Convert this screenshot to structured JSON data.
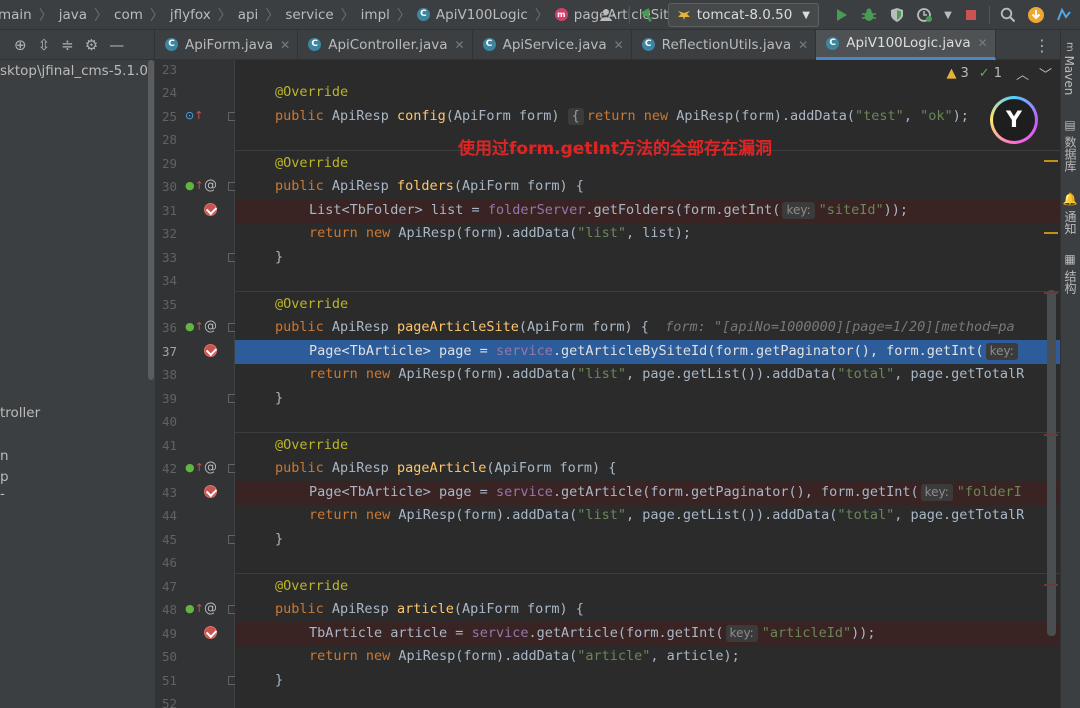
{
  "breadcrumb": [
    "main",
    "java",
    "com",
    "jflyfox",
    "api",
    "service",
    "impl",
    "ApiV100Logic",
    "pageArticleSite"
  ],
  "toolbar": {
    "run_config": "tomcat-8.0.50",
    "user_icon": "user-icon",
    "build_icon": "hammer-icon",
    "run_icon": "play-icon",
    "debug_icon": "bug-icon",
    "stop_icon": "stop-icon",
    "search_icon": "search-icon",
    "update_icon": "update-icon",
    "colors": {
      "run": "#499c54",
      "stop": "#c75450",
      "update": "#f0a732"
    }
  },
  "tabs": [
    {
      "label": "ApiForm.java",
      "active": false
    },
    {
      "label": "ApiController.java",
      "active": false
    },
    {
      "label": "ApiService.java",
      "active": false
    },
    {
      "label": "ReflectionUtils.java",
      "active": false
    },
    {
      "label": "ApiV100Logic.java",
      "active": true
    }
  ],
  "project_panel": {
    "path": "sktop\\jfinal_cms-5.1.0",
    "items": [
      "troller",
      "n",
      "p",
      "-"
    ]
  },
  "inspections": {
    "warnings": "3",
    "ok": "1"
  },
  "annotation_text": "使用过form.getInt方法的全部存在漏洞",
  "right_tools": [
    "Maven",
    "数据库",
    "通知",
    "结构"
  ],
  "editor": {
    "line_numbers": [
      "23",
      "24",
      "25",
      "28",
      "29",
      "30",
      "31",
      "32",
      "33",
      "34",
      "35",
      "36",
      "37",
      "38",
      "39",
      "40",
      "41",
      "42",
      "43",
      "44",
      "45",
      "46",
      "47",
      "48",
      "49",
      "50",
      "51",
      "52"
    ],
    "current_line": "37",
    "breakpoint_lines": [
      "31",
      "37",
      "43",
      "49"
    ],
    "hint_key": "key:",
    "lines": {
      "l24": "@Override",
      "l25_a": "public",
      "l25_b": "ApiResp",
      "l25_c": "config",
      "l25_d": "(ApiForm form) ",
      "l25_fold": "{",
      "l25_e": "return new",
      "l25_f": " ApiResp(form).addData(",
      "l25_g": "\"test\"",
      "l25_h": ", ",
      "l25_i": "\"ok\"",
      "l25_j": ");",
      "l29": "@Override",
      "l30_a": "public",
      "l30_b": " ApiResp ",
      "l30_c": "folders",
      "l30_d": "(ApiForm form) {",
      "l31_a": "List<TbFolder> list = ",
      "l31_b": "folderServer",
      "l31_c": ".getFolders(form.getInt(",
      "l31_d": "\"siteId\"",
      "l31_e": "));",
      "l32_a": "return new",
      "l32_b": " ApiResp(form).addData(",
      "l32_c": "\"list\"",
      "l32_d": ", list);",
      "l33": "}",
      "l35": "@Override",
      "l36_a": "public",
      "l36_b": " ApiResp ",
      "l36_c": "pageArticleSite",
      "l36_d": "(ApiForm form) {",
      "l36_e": "form: \"[apiNo=1000000][page=1/20][method=pa",
      "l37_a": "Page<TbArticle> page = ",
      "l37_b": "service",
      "l37_c": ".getArticleBySiteId(form.getPaginator(), form.getInt(",
      "l38_a": "return new",
      "l38_b": " ApiResp(form).addData(",
      "l38_c": "\"list\"",
      "l38_d": ", page.getList()).addData(",
      "l38_e": "\"total\"",
      "l38_f": ", page.getTotalR",
      "l39": "}",
      "l41": "@Override",
      "l42_a": "public",
      "l42_b": " ApiResp ",
      "l42_c": "pageArticle",
      "l42_d": "(ApiForm form) {",
      "l43_a": "Page<TbArticle> page = ",
      "l43_b": "service",
      "l43_c": ".getArticle(form.getPaginator(), form.getInt(",
      "l43_d": "\"folderI",
      "l44_a": "return new",
      "l44_b": " ApiResp(form).addData(",
      "l44_c": "\"list\"",
      "l44_d": ", page.getList()).addData(",
      "l44_e": "\"total\"",
      "l44_f": ", page.getTotalR",
      "l45": "}",
      "l47": "@Override",
      "l48_a": "public",
      "l48_b": " ApiResp ",
      "l48_c": "article",
      "l48_d": "(ApiForm form) {",
      "l49_a": "TbArticle article = ",
      "l49_b": "service",
      "l49_c": ".getArticle(form.getInt(",
      "l49_d": "\"articleId\"",
      "l49_e": "));",
      "l50_a": "return new",
      "l50_b": " ApiResp(form).addData(",
      "l50_c": "\"article\"",
      "l50_d": ", article);",
      "l51": "}"
    }
  }
}
